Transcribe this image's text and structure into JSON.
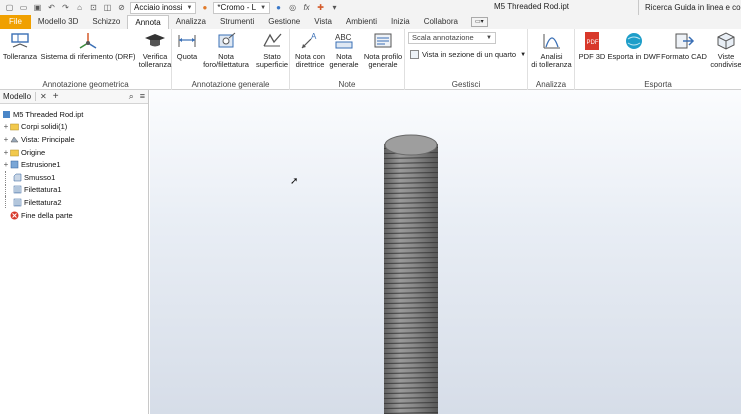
{
  "qat": {
    "material": "Acciaio inossi",
    "appearance": "*Cromo - L",
    "fx": "fx"
  },
  "window": {
    "title": "M5 Threaded Rod.ipt",
    "help_search": "Ricerca Guida in linea e co"
  },
  "tabs": [
    "File",
    "Modello 3D",
    "Schizzo",
    "Annota",
    "Analizza",
    "Strumenti",
    "Gestione",
    "Vista",
    "Ambienti",
    "Inizia",
    "Collabora"
  ],
  "active_tab": "Annota",
  "ribbon": {
    "geometrica": {
      "title": "Annotazione geometrica",
      "tolleranza": "Tolleranza",
      "drf": "Sistema di riferimento (DRF)",
      "verifica_1": "Verifica",
      "verifica_2": "tolleranza"
    },
    "generale": {
      "title": "Annotazione generale",
      "quota": "Quota",
      "nota_foro_1": "Nota",
      "nota_foro_2": "foro/filettatura",
      "stato_1": "Stato",
      "stato_2": "superficie"
    },
    "note": {
      "title": "Note",
      "direttrice_1": "Nota con",
      "direttrice_2": "direttrice",
      "generale_1": "Nota",
      "generale_2": "generale",
      "profilo_1": "Nota profilo",
      "profilo_2": "generale"
    },
    "gestisci": {
      "title": "Gestisci",
      "scala": "Scala annotazione",
      "vista_sezione": "Vista in sezione di un quarto"
    },
    "analizza": {
      "title": "Analizza",
      "analisi_1": "Analisi",
      "analisi_2": "di tolleranza"
    },
    "esporta": {
      "title": "Esporta",
      "pdf3d": "PDF 3D",
      "dwf": "Esporta in DWF",
      "cad": "Formato CAD",
      "viste_1": "Viste",
      "viste_2": "condivise"
    }
  },
  "browser": {
    "tab_label": "Modello",
    "nodes": [
      {
        "label": "M5 Threaded Rod.ipt"
      },
      {
        "label": "Corpi solidi(1)"
      },
      {
        "label": "Vista: Principale"
      },
      {
        "label": "Origine"
      },
      {
        "label": "Estrusione1"
      },
      {
        "label": "Smusso1"
      },
      {
        "label": "Filettatura1"
      },
      {
        "label": "Filettatura2"
      },
      {
        "label": "Fine della parte"
      }
    ]
  },
  "colors": {
    "file_tab": "#f0a000",
    "viewport_top": "#fbfcfe",
    "viewport_bottom": "#d6dde8",
    "rod": "#8a8a8a"
  }
}
